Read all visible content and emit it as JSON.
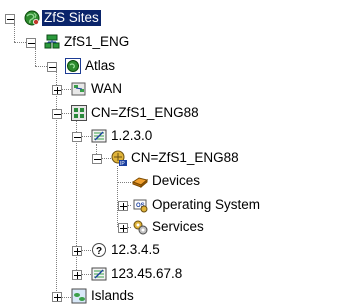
{
  "tree": {
    "root": {
      "label": "ZfS Sites",
      "icon": "globe-icon"
    },
    "server": {
      "label": "ZfS1_ENG",
      "icon": "network-server-icon"
    },
    "site": {
      "label": "Atlas",
      "icon": "site-globe-icon"
    },
    "wan": {
      "label": "WAN",
      "icon": "wan-icon"
    },
    "cn_eng": {
      "label": "CN=ZfS1_ENG88",
      "icon": "directory-container-icon"
    },
    "ip1": {
      "label": "1.2.3.0",
      "icon": "subnet-icon"
    },
    "cn_sub": {
      "label": "CN=ZfS1_ENG88",
      "icon": "ip-server-icon"
    },
    "devices": {
      "label": "Devices",
      "icon": "devices-icon"
    },
    "os": {
      "label": "Operating System",
      "icon": "operating-system-icon"
    },
    "services": {
      "label": "Services",
      "icon": "services-icon"
    },
    "ip2": {
      "label": "12.3.4.5",
      "icon": "unknown-question-icon"
    },
    "ip3": {
      "label": "123.45.67.8",
      "icon": "subnet-icon"
    },
    "islands": {
      "label": "Islands",
      "icon": "islands-icon"
    }
  }
}
